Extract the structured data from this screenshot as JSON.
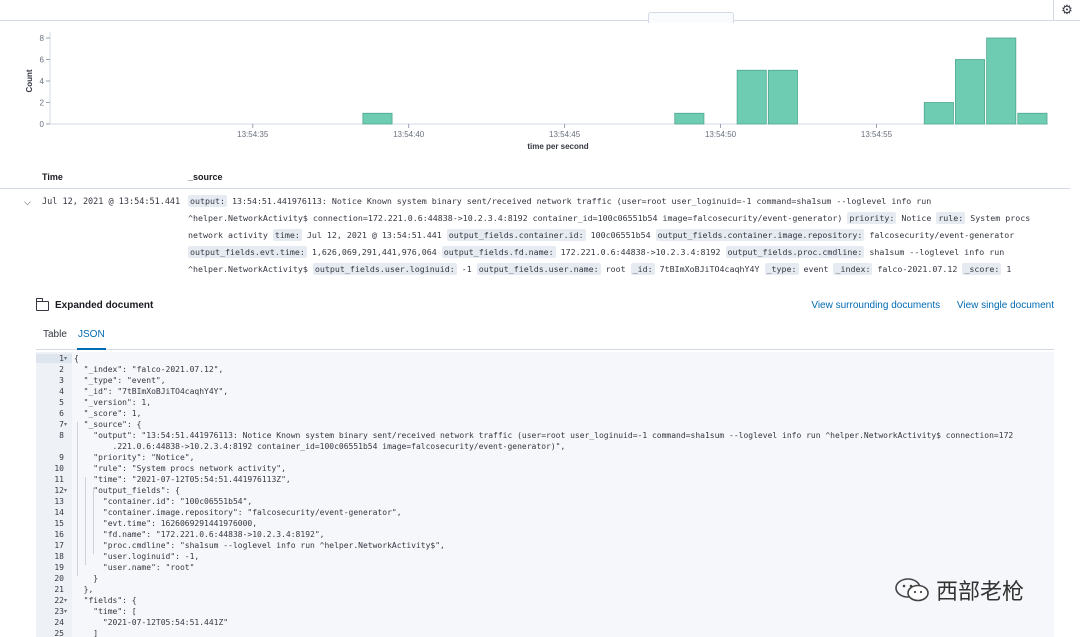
{
  "chart_data": {
    "type": "bar",
    "x_unit": "seconds",
    "x_range": [
      "13:54:29",
      "13:55:00"
    ],
    "bars": [
      {
        "x": "13:54:39",
        "y": 1
      },
      {
        "x": "13:54:49",
        "y": 1
      },
      {
        "x": "13:54:51",
        "y": 5
      },
      {
        "x": "13:54:52",
        "y": 5
      },
      {
        "x": "13:54:57",
        "y": 2
      },
      {
        "x": "13:54:58",
        "y": 6
      },
      {
        "x": "13:54:59",
        "y": 8
      },
      {
        "x": "13:55:00",
        "y": 1
      }
    ],
    "xticks": [
      "13:54:35",
      "13:54:40",
      "13:54:45",
      "13:54:50",
      "13:54:55"
    ],
    "yticks": [
      "0",
      "2",
      "4",
      "6",
      "8"
    ],
    "ylim": [
      0,
      8
    ],
    "xlabel": "time per second",
    "ylabel": "Count",
    "bar_color": "#6dccb1"
  },
  "table": {
    "col_time": "Time",
    "col_source": "_source"
  },
  "row": {
    "time": "Jul 12, 2021 @ 13:54:51.441",
    "fields": [
      {
        "k": "output:",
        "v": "13:54:51.441976113: Notice Known system binary sent/received network traffic (user=root user_loginuid=-1 command=sha1sum --loglevel info run ^helper.NetworkActivity$ connection=172.221.0.6:44838->10.2.3.4:8192 container_id=100c06551b54 image=falcosecurity/event-generator)"
      },
      {
        "k": "priority:",
        "v": "Notice"
      },
      {
        "k": "rule:",
        "v": "System procs network activity"
      },
      {
        "k": "time:",
        "v": "Jul 12, 2021 @ 13:54:51.441"
      },
      {
        "k": "output_fields.container.id:",
        "v": "100c06551b54"
      },
      {
        "k": "output_fields.container.image.repository:",
        "v": "falcosecurity/event-generator"
      },
      {
        "k": "output_fields.evt.time:",
        "v": "1,626,069,291,441,976,064"
      },
      {
        "k": "output_fields.fd.name:",
        "v": "172.221.0.6:44838->10.2.3.4:8192"
      },
      {
        "k": "output_fields.proc.cmdline:",
        "v": "sha1sum --loglevel info run ^helper.NetworkActivity$"
      },
      {
        "k": "output_fields.user.loginuid:",
        "v": "-1"
      },
      {
        "k": "output_fields.user.name:",
        "v": "root"
      },
      {
        "k": "_id:",
        "v": "7tBImXoBJiTO4caqhY4Y"
      },
      {
        "k": "_type:",
        "v": "event"
      },
      {
        "k": "_index:",
        "v": "falco-2021.07.12"
      },
      {
        "k": "_score:",
        "v": "1"
      }
    ]
  },
  "expanded": {
    "title": "Expanded document",
    "link_surrounding": "View surrounding documents",
    "link_single": "View single document",
    "tab_table": "Table",
    "tab_json": "JSON"
  },
  "json_lines": [
    {
      "n": "1",
      "fold": true,
      "text": "{"
    },
    {
      "n": "2",
      "text": "  \"_index\": \"falco-2021.07.12\","
    },
    {
      "n": "3",
      "text": "  \"_type\": \"event\","
    },
    {
      "n": "4",
      "text": "  \"_id\": \"7tBImXoBJiTO4caqhY4Y\","
    },
    {
      "n": "5",
      "text": "  \"_version\": 1,"
    },
    {
      "n": "6",
      "text": "  \"_score\": 1,"
    },
    {
      "n": "7",
      "fold": true,
      "text": "  \"_source\": {"
    },
    {
      "n": "8",
      "text": "    \"output\": \"13:54:51.441976113: Notice Known system binary sent/received network traffic (user=root user_loginuid=-1 command=sha1sum --loglevel info run ^helper.NetworkActivity$ connection=172"
    },
    {
      "n": "",
      "text": "        .221.0.6:44838->10.2.3.4:8192 container_id=100c06551b54 image=falcosecurity/event-generator)\","
    },
    {
      "n": "9",
      "text": "    \"priority\": \"Notice\","
    },
    {
      "n": "10",
      "text": "    \"rule\": \"System procs network activity\","
    },
    {
      "n": "11",
      "text": "    \"time\": \"2021-07-12T05:54:51.441976113Z\","
    },
    {
      "n": "12",
      "fold": true,
      "text": "    \"output_fields\": {"
    },
    {
      "n": "13",
      "text": "      \"container.id\": \"100c06551b54\","
    },
    {
      "n": "14",
      "text": "      \"container.image.repository\": \"falcosecurity/event-generator\","
    },
    {
      "n": "15",
      "text": "      \"evt.time\": 1626069291441976000,"
    },
    {
      "n": "16",
      "text": "      \"fd.name\": \"172.221.0.6:44838->10.2.3.4:8192\","
    },
    {
      "n": "17",
      "text": "      \"proc.cmdline\": \"sha1sum --loglevel info run ^helper.NetworkActivity$\","
    },
    {
      "n": "18",
      "text": "      \"user.loginuid\": -1,"
    },
    {
      "n": "19",
      "text": "      \"user.name\": \"root\""
    },
    {
      "n": "20",
      "text": "    }"
    },
    {
      "n": "21",
      "text": "  },"
    },
    {
      "n": "22",
      "fold": true,
      "text": "  \"fields\": {"
    },
    {
      "n": "23",
      "fold": true,
      "text": "    \"time\": ["
    },
    {
      "n": "24",
      "text": "      \"2021-07-12T05:54:51.441Z\""
    },
    {
      "n": "25",
      "text": "    ]"
    }
  ],
  "watermark": "西部老枪",
  "icons": {
    "settings": "gear-icon",
    "expand": "chevron-down-icon",
    "folder": "folder-icon",
    "watermark": "wechat-icon"
  }
}
